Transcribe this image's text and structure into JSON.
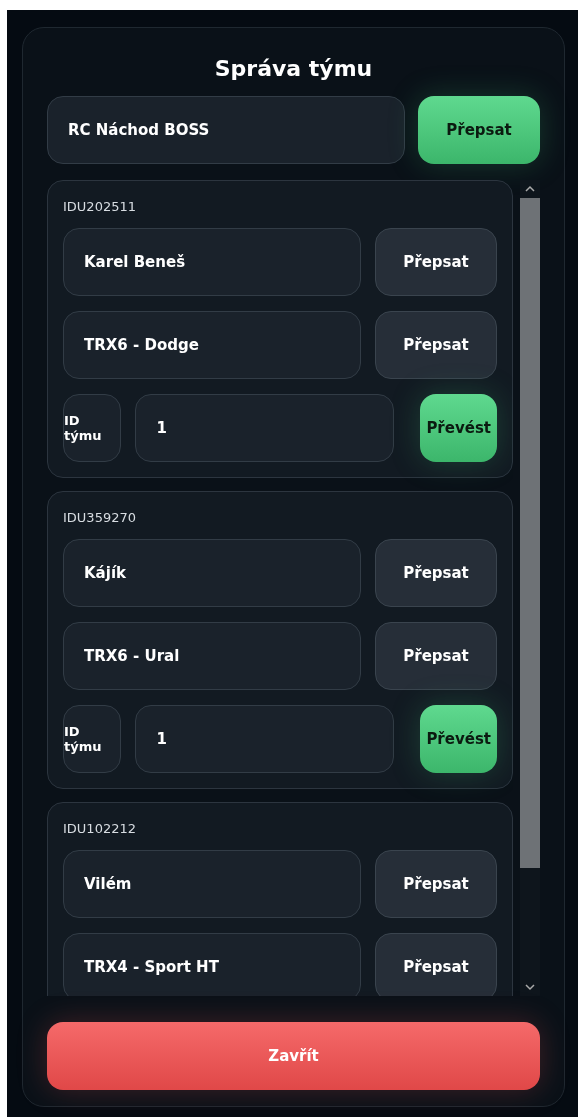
{
  "dialog": {
    "title": "Správa týmu"
  },
  "team": {
    "name": "RC Náchod BOSS",
    "button": "Přepsat"
  },
  "members": [
    {
      "id": "IDU202511",
      "rows": [
        {
          "kind": "field",
          "value": "Karel Beneš",
          "button": "Přepsat"
        },
        {
          "kind": "field",
          "value": "TRX6 - Dodge",
          "button": "Přepsat"
        },
        {
          "kind": "team",
          "label": "ID týmu",
          "value": "1",
          "button": "Převést"
        }
      ]
    },
    {
      "id": "IDU359270",
      "rows": [
        {
          "kind": "field",
          "value": "Kájík",
          "button": "Přepsat"
        },
        {
          "kind": "field",
          "value": "TRX6 - Ural",
          "button": "Přepsat"
        },
        {
          "kind": "team",
          "label": "ID týmu",
          "value": "1",
          "button": "Převést"
        }
      ]
    },
    {
      "id": "IDU102212",
      "rows": [
        {
          "kind": "field",
          "value": "Vilém",
          "button": "Přepsat"
        },
        {
          "kind": "field",
          "value": "TRX4 - Sport HT",
          "button": "Přepsat"
        }
      ]
    }
  ],
  "close_button": "Zavřít"
}
